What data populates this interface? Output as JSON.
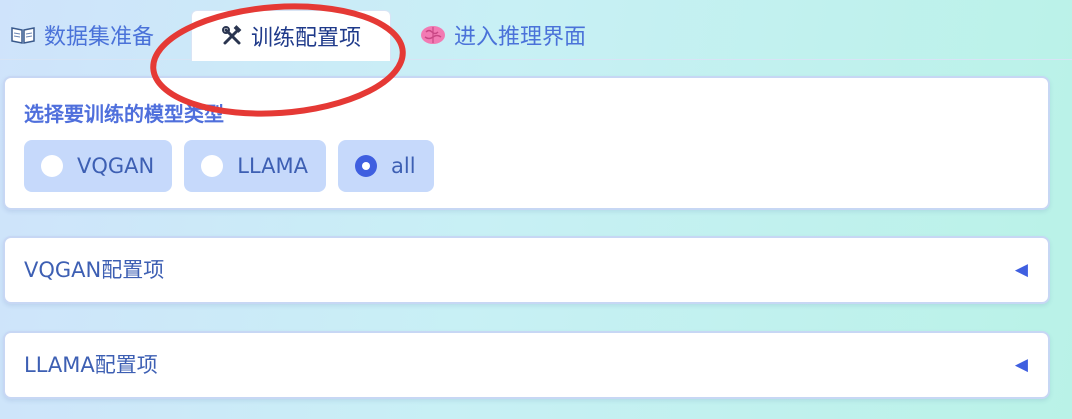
{
  "tabs": [
    {
      "label": "数据集准备",
      "icon": "open-book-icon"
    },
    {
      "label": "训练配置项",
      "icon": "hammer-wrench-icon",
      "selected": true
    },
    {
      "label": "进入推理界面",
      "icon": "brain-icon"
    }
  ],
  "model_select": {
    "title": "选择要训练的模型类型",
    "options": [
      {
        "label": "VQGAN",
        "checked": false
      },
      {
        "label": "LLAMA",
        "checked": false
      },
      {
        "label": "all",
        "checked": true
      }
    ]
  },
  "accordions": [
    {
      "label": "VQGAN配置项",
      "arrow": "◀"
    },
    {
      "label": "LLAMA配置项",
      "arrow": "◀"
    }
  ],
  "colors": {
    "accent": "#3f5fe0",
    "text": "#3d5fb3",
    "annotation": "#e53935"
  }
}
